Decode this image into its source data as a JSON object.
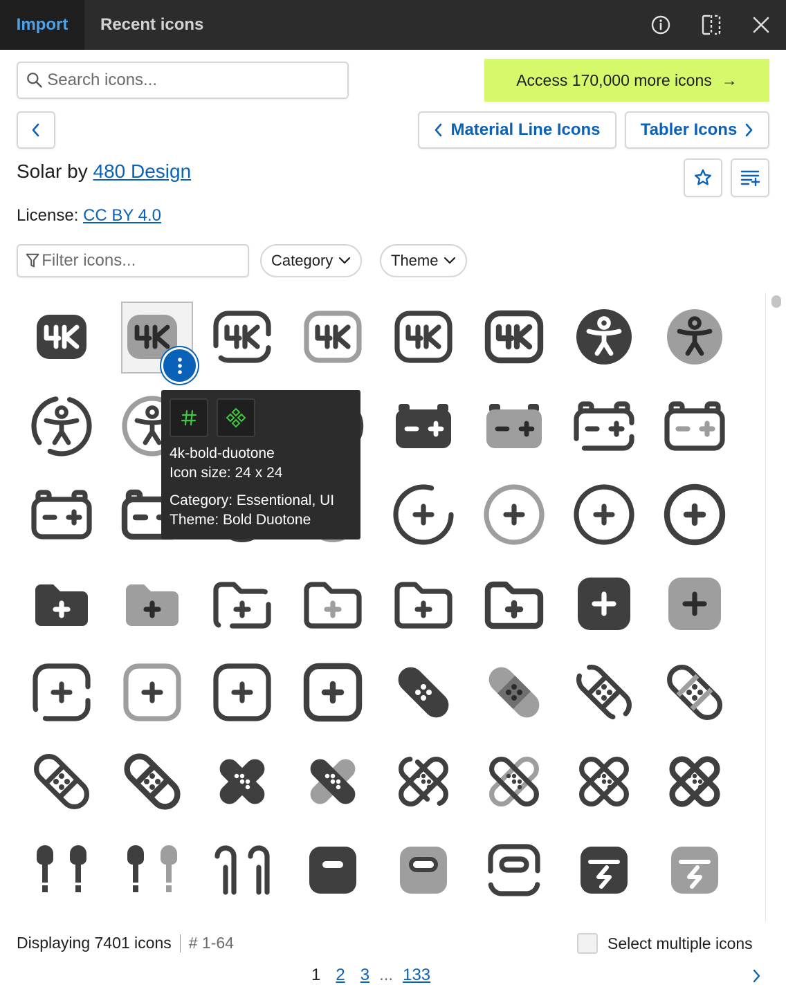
{
  "tabs": {
    "import": "Import",
    "recent": "Recent icons"
  },
  "search": {
    "placeholder": "Search icons..."
  },
  "promo": {
    "label": "Access 170,000 more icons",
    "arrow": "→",
    "color": "#d6f96b"
  },
  "nav": {
    "prev_label": "Material Line Icons",
    "next_label": "Tabler Icons"
  },
  "set": {
    "title_prefix": "Solar by",
    "author": "480 Design"
  },
  "license": {
    "label": "License:",
    "value": "CC BY 4.0"
  },
  "filter": {
    "placeholder": "Filter icons...",
    "category_label": "Category",
    "theme_label": "Theme"
  },
  "tooltip": {
    "name": "4k-bold-duotone",
    "size": "Icon size: 24 x 24",
    "category": "Category: Essentional, UI",
    "theme": "Theme: Bold Duotone"
  },
  "footer": {
    "count": "Displaying 7401 icons",
    "range": "# 1-64",
    "multi_label": "Select multiple icons"
  },
  "pagination": {
    "current": "1",
    "pages": [
      "2",
      "3"
    ],
    "ellipsis": "...",
    "last": "133"
  },
  "colors": {
    "accent": "#0a61b8",
    "icon_dark": "#3f3f3f",
    "icon_light": "#9e9e9e",
    "topbar": "#2c2c2c"
  },
  "icons": [
    "4k-bold",
    "4k-bold-duotone",
    "4k-broken",
    "4k-line-duotone",
    "4k-linear",
    "4k-outline",
    "accessibility-bold",
    "accessibility-bold-duotone",
    "accessibility-broken",
    "accessibility-line-duotone",
    "accessibility-linear",
    "accessibility-outline",
    "accumulator-bold",
    "accumulator-bold-duotone",
    "accumulator-broken",
    "accumulator-line-duotone",
    "accumulator-linear",
    "accumulator-outline",
    "add-circle-bold",
    "add-circle-bold-duotone",
    "add-circle-broken",
    "add-circle-line-duotone",
    "add-circle-linear",
    "add-circle-outline",
    "add-folder-bold",
    "add-folder-bold-duotone",
    "add-folder-broken",
    "add-folder-line-duotone",
    "add-folder-linear",
    "add-folder-outline",
    "add-square-bold",
    "add-square-bold-duotone",
    "add-square-broken",
    "add-square-line-duotone",
    "add-square-linear",
    "add-square-outline",
    "adhesive-plaster-bold",
    "adhesive-plaster-bold-duotone",
    "adhesive-plaster-broken",
    "adhesive-plaster-line-duotone",
    "adhesive-plaster-linear",
    "adhesive-plaster-outline",
    "adhesive-plaster-2-bold",
    "adhesive-plaster-2-bold-duotone",
    "adhesive-plaster-2-broken",
    "adhesive-plaster-2-line-duotone",
    "adhesive-plaster-2-linear",
    "adhesive-plaster-2-outline",
    "airbuds-bold",
    "airbuds-bold-duotone",
    "airbuds-broken",
    "airbuds-case-bold",
    "airbuds-case-bold-duotone",
    "airbuds-case-broken",
    "airbuds-case-charge-bold",
    "airbuds-case-charge-bold-duotone"
  ]
}
